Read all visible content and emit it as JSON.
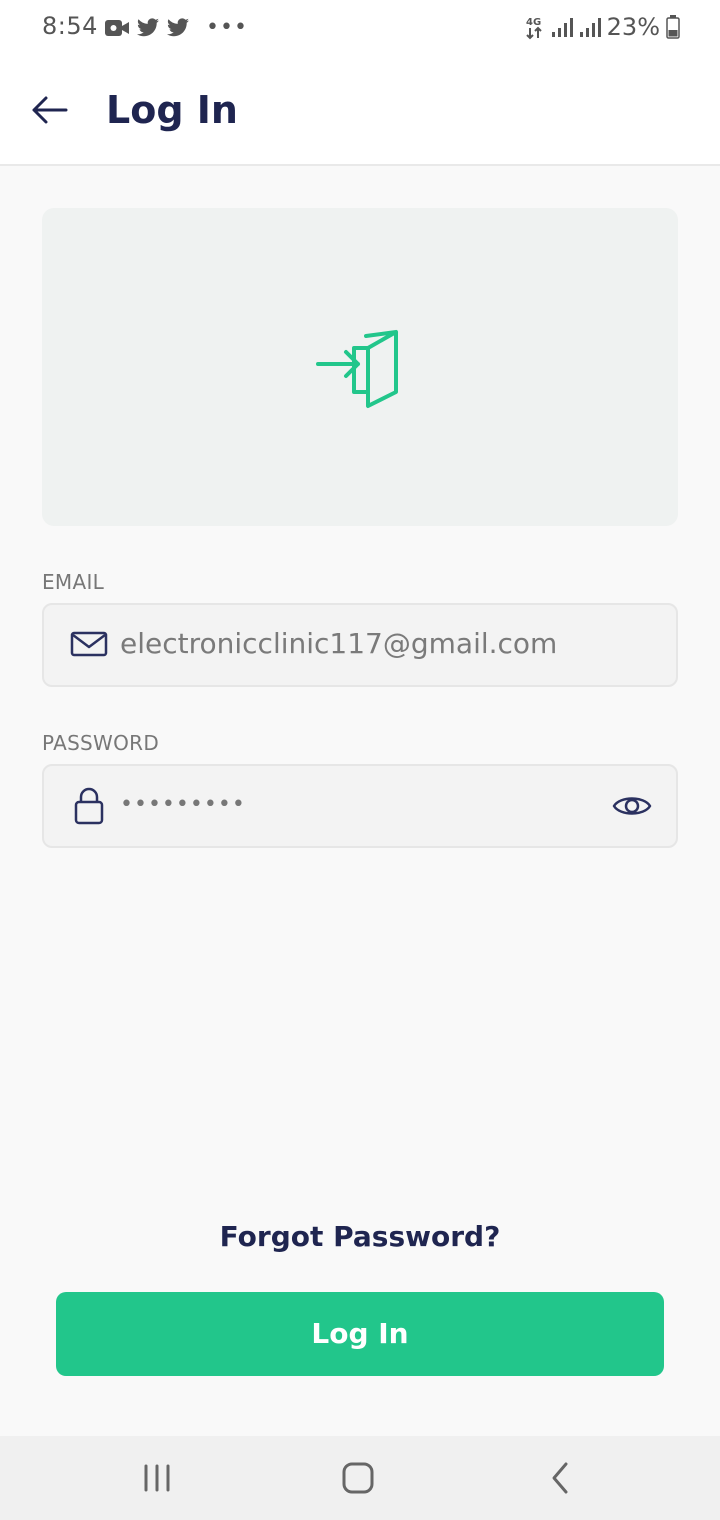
{
  "status_bar": {
    "time": "8:54",
    "network": "4G",
    "battery": "23%",
    "icons": [
      "video-call-icon",
      "twitter-icon",
      "twitter-icon",
      "more-notifications-icon",
      "network-4g-icon",
      "signal-icon",
      "signal-icon",
      "battery-icon"
    ]
  },
  "app_bar": {
    "title": "Log In",
    "back_icon": "back-arrow-icon"
  },
  "hero": {
    "icon": "login-door-icon",
    "accent": "#22c68b"
  },
  "form": {
    "email_label": "EMAIL",
    "email_value": "electronicclinic117@gmail.com",
    "email_icon": "mail-icon",
    "password_label": "PASSWORD",
    "password_value": "•••••••••",
    "password_icon": "lock-icon",
    "visibility_icon": "eye-icon"
  },
  "actions": {
    "forgot_password": "Forgot Password?",
    "login_button": "Log In",
    "button_color": "#22c68b"
  },
  "nav_bar": {
    "icons": [
      "recent-apps-icon",
      "home-icon",
      "back-icon"
    ]
  }
}
